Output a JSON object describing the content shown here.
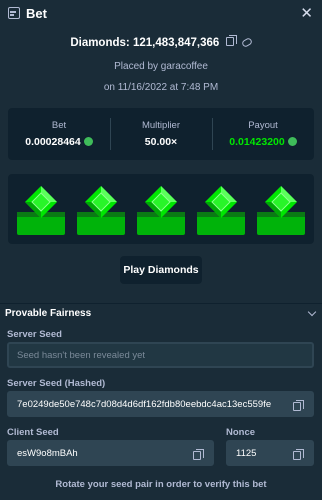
{
  "header": {
    "title": "Bet",
    "close_glyph": "✕"
  },
  "summary": {
    "game_label": "Diamonds:",
    "bet_id": "121,483,847,366",
    "placed_by": "Placed by garacoffee",
    "placed_on": "on 11/16/2022 at 7:48 PM"
  },
  "stats": {
    "bet_label": "Bet",
    "bet_value": "0.00028464",
    "multiplier_label": "Multiplier",
    "multiplier_value": "50.00×",
    "payout_label": "Payout",
    "payout_value": "0.01423200"
  },
  "colors": {
    "coin": "#3fbc5a",
    "gem": "#00e701",
    "payout": "#00e701"
  },
  "board": {
    "gem_count": 5,
    "gem_icon": "green-diamond-icon"
  },
  "play_button": {
    "label": "Play Diamonds"
  },
  "fairness": {
    "title": "Provable Fairness",
    "server_seed_label": "Server Seed",
    "server_seed_placeholder": "Seed hasn't been revealed yet",
    "hashed_label": "Server Seed (Hashed)",
    "hashed_value": "7e0249de50e748c7d08d4d6df162fdb80eebdc4ac13ec559fe",
    "client_seed_label": "Client Seed",
    "client_seed_value": "esW9o8mBAh",
    "nonce_label": "Nonce",
    "nonce_value": "1125",
    "footer": "Rotate your seed pair in order to verify this bet"
  }
}
